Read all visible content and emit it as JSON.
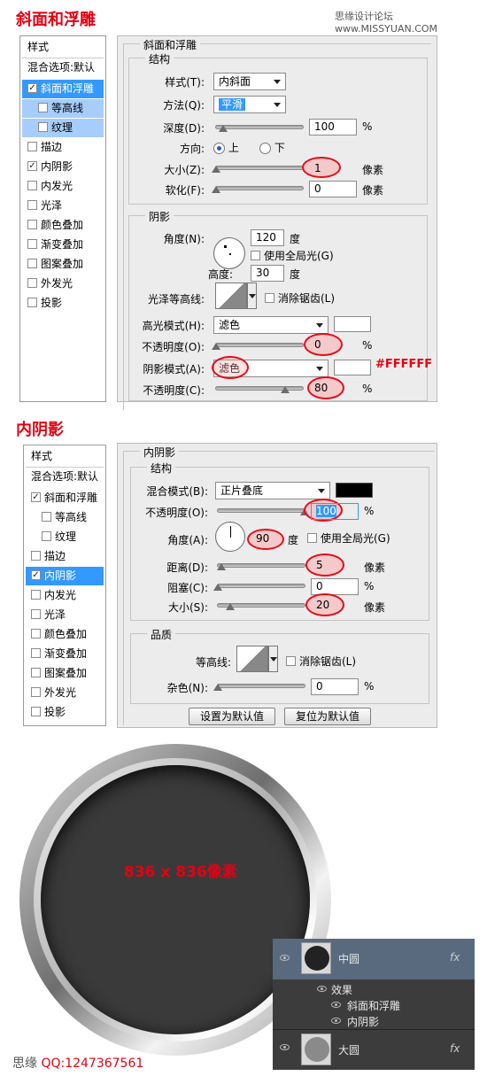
{
  "site": {
    "watermark": "思缘设计论坛  www.MISSYUAN.COM",
    "bottom_watermark": "思缘",
    "bottom_qq": "QQ:1247367561"
  },
  "bevel_section": {
    "title": "斜面和浮雕",
    "sidebar": {
      "header": "样式",
      "blend": "混合选项:默认",
      "items": [
        {
          "label": "斜面和浮雕",
          "checked": true
        },
        {
          "label": "等高线",
          "checked": false
        },
        {
          "label": "纹理",
          "checked": false
        },
        {
          "label": "描边",
          "checked": false
        },
        {
          "label": "内阴影",
          "checked": true
        },
        {
          "label": "内发光",
          "checked": false
        },
        {
          "label": "光泽",
          "checked": false
        },
        {
          "label": "颜色叠加",
          "checked": false
        },
        {
          "label": "渐变叠加",
          "checked": false
        },
        {
          "label": "图案叠加",
          "checked": false
        },
        {
          "label": "外发光",
          "checked": false
        },
        {
          "label": "投影",
          "checked": false
        }
      ]
    },
    "panel_title": "斜面和浮雕",
    "structure": {
      "title": "结构",
      "style_label": "样式(T):",
      "style_value": "内斜面",
      "method_label": "方法(Q):",
      "method_value": "平滑",
      "depth_label": "深度(D):",
      "depth_value": "100",
      "depth_unit": "%",
      "direction_label": "方向:",
      "dir_up": "上",
      "dir_down": "下",
      "size_label": "大小(Z):",
      "size_value": "1",
      "size_unit": "像素",
      "soften_label": "软化(F):",
      "soften_value": "0",
      "soften_unit": "像素"
    },
    "shading": {
      "title": "阴影",
      "angle_label": "角度(N):",
      "angle_value": "120",
      "angle_unit": "度",
      "global_light": "使用全局光(G)",
      "altitude_label": "高度:",
      "altitude_value": "30",
      "altitude_unit": "度",
      "gloss_label": "光泽等高线:",
      "antialias": "消除锯齿(L)",
      "highlight_label": "高光模式(H):",
      "highlight_value": "滤色",
      "hl_opacity_label": "不透明度(O):",
      "hl_opacity_value": "0",
      "hl_opacity_unit": "%",
      "shadow_label": "阴影模式(A):",
      "shadow_value": "滤色",
      "shadow_color_text": "#FFFFFF",
      "sh_opacity_label": "不透明度(C):",
      "sh_opacity_value": "80",
      "sh_opacity_unit": "%"
    }
  },
  "inner_section": {
    "title": "内阴影",
    "sidebar": {
      "header": "样式",
      "blend": "混合选项:默认",
      "items": [
        {
          "label": "斜面和浮雕",
          "checked": true
        },
        {
          "label": "等高线",
          "checked": false
        },
        {
          "label": "纹理",
          "checked": false
        },
        {
          "label": "描边",
          "checked": false
        },
        {
          "label": "内阴影",
          "checked": true
        },
        {
          "label": "内发光",
          "checked": false
        },
        {
          "label": "光泽",
          "checked": false
        },
        {
          "label": "颜色叠加",
          "checked": false
        },
        {
          "label": "渐变叠加",
          "checked": false
        },
        {
          "label": "图案叠加",
          "checked": false
        },
        {
          "label": "外发光",
          "checked": false
        },
        {
          "label": "投影",
          "checked": false
        }
      ]
    },
    "panel_title": "内阴影",
    "structure": {
      "title": "结构",
      "blend_label": "混合模式(B):",
      "blend_value": "正片叠底",
      "opacity_label": "不透明度(O):",
      "opacity_value": "100",
      "opacity_unit": "%",
      "angle_label": "角度(A):",
      "angle_value": "90",
      "angle_unit": "度",
      "global_light": "使用全局光(G)",
      "distance_label": "距离(D):",
      "distance_value": "5",
      "distance_unit": "像素",
      "choke_label": "阻塞(C):",
      "choke_value": "0",
      "choke_unit": "%",
      "size_label": "大小(S):",
      "size_value": "20",
      "size_unit": "像素"
    },
    "quality": {
      "title": "品质",
      "contour_label": "等高线:",
      "antialias": "消除锯齿(L)",
      "noise_label": "杂色(N):",
      "noise_value": "0",
      "noise_unit": "%"
    },
    "buttons": {
      "set_default": "设置为默认值",
      "reset_default": "复位为默认值"
    }
  },
  "preview": {
    "size_text": "836 x 836像素"
  },
  "layers": {
    "layer1": "中圆",
    "effects": "效果",
    "effect1": "斜面和浮雕",
    "effect2": "内阴影",
    "layer2": "大圆",
    "fx": "fx"
  },
  "colors": {
    "accent_red": "#e60012",
    "selection_blue": "#3399ff",
    "shadow_color": "#000000"
  }
}
